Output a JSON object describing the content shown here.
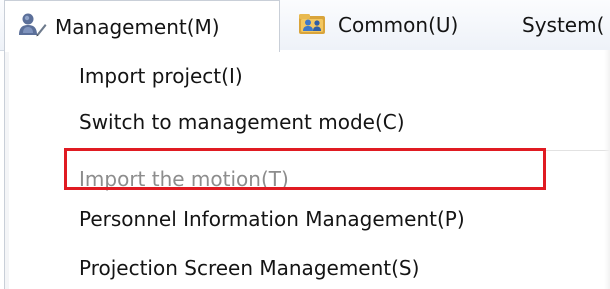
{
  "menubar": {
    "menus": [
      {
        "label": "Management(M)",
        "icon": "user-icon",
        "active": true
      },
      {
        "label": "Common(U)",
        "icon": "users-folder-icon",
        "active": false
      },
      {
        "label": "System(",
        "icon": "",
        "active": false
      }
    ]
  },
  "dropdown": {
    "items": [
      {
        "label": "Import project(I)",
        "enabled": true
      },
      {
        "label": "Switch to management mode(C)",
        "enabled": true
      },
      {
        "label": "Import the motion(T)",
        "enabled": false
      },
      {
        "label": "Personnel Information Management(P)",
        "enabled": true,
        "highlighted": true
      },
      {
        "label": "Projection Screen Management(S)",
        "enabled": true
      }
    ]
  },
  "colors": {
    "highlight_border": "#e01b22",
    "disabled_text": "#8d8d8d",
    "menubar_bg": "#eef2f8"
  }
}
